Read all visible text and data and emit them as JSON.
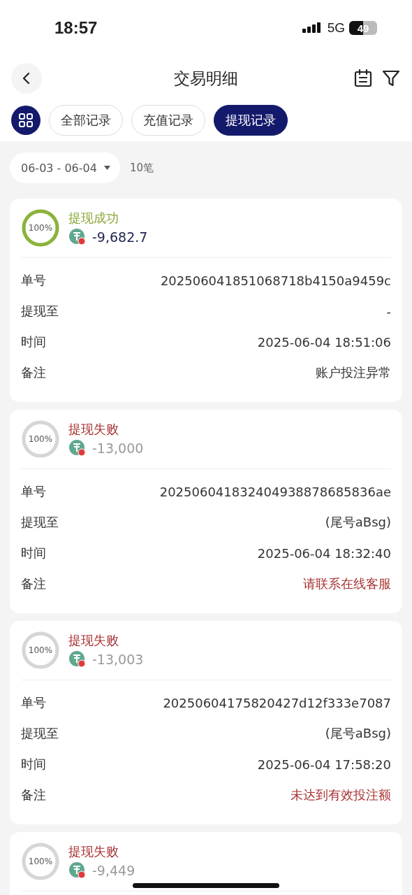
{
  "status_bar": {
    "time": "18:57",
    "network": "5G",
    "battery": "49"
  },
  "header": {
    "title": "交易明细"
  },
  "tabs": [
    {
      "label": "全部记录",
      "selected": false
    },
    {
      "label": "充值记录",
      "selected": false
    },
    {
      "label": "提现记录",
      "selected": true
    }
  ],
  "filter": {
    "date_range": "06-03 - 06-04",
    "count": "10笔"
  },
  "records": [
    {
      "kind": "success",
      "progress": "100%",
      "status": "提现成功",
      "amount": "-9,682.7",
      "fields": [
        {
          "label": "单号",
          "value": "202506041851068718b4150a9459c",
          "alert": false
        },
        {
          "label": "提现至",
          "value": "-",
          "alert": false
        },
        {
          "label": "时间",
          "value": "2025-06-04 18:51:06",
          "alert": false
        },
        {
          "label": "备注",
          "value": "账户投注异常",
          "alert": false
        }
      ]
    },
    {
      "kind": "failed",
      "progress": "100%",
      "status": "提现失败",
      "amount": "-13,000",
      "fields": [
        {
          "label": "单号",
          "value": "202506041832404938878685836ae",
          "alert": false
        },
        {
          "label": "提现至",
          "value": "(尾号aBsg)",
          "alert": false
        },
        {
          "label": "时间",
          "value": "2025-06-04 18:32:40",
          "alert": false
        },
        {
          "label": "备注",
          "value": "请联系在线客服",
          "alert": true
        }
      ]
    },
    {
      "kind": "failed",
      "progress": "100%",
      "status": "提现失败",
      "amount": "-13,003",
      "fields": [
        {
          "label": "单号",
          "value": "20250604175820427d12f333e7087",
          "alert": false
        },
        {
          "label": "提现至",
          "value": "(尾号aBsg)",
          "alert": false
        },
        {
          "label": "时间",
          "value": "2025-06-04 17:58:20",
          "alert": false
        },
        {
          "label": "备注",
          "value": "未达到有效投注额",
          "alert": true
        }
      ]
    },
    {
      "kind": "failed",
      "progress": "100%",
      "status": "提现失败",
      "amount": "-9,449"
    }
  ]
}
